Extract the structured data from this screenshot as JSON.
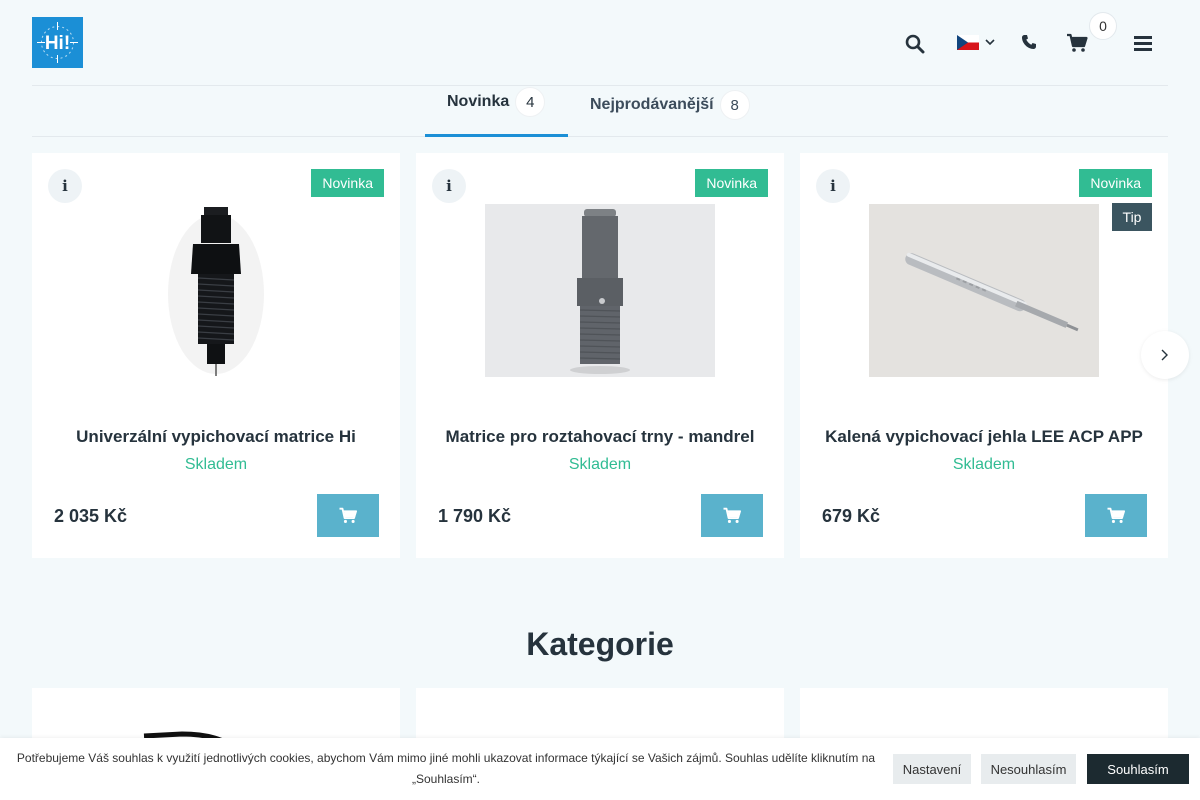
{
  "header": {
    "logo_text": "Hi!",
    "cart_count": "0",
    "icons": [
      "search-icon",
      "czech-flag-icon",
      "chevron-down-icon",
      "phone-icon",
      "cart-icon",
      "menu-icon"
    ]
  },
  "tabs": [
    {
      "label": "Novinka",
      "count": "4",
      "active": true
    },
    {
      "label": "Nejprodávanější",
      "count": "8",
      "active": false
    }
  ],
  "products": [
    {
      "name": "Univerzální vypichovací matrice Hi",
      "stock": "Skladem",
      "price": "2 035 Kč",
      "flag_new": "Novinka",
      "flag_tip": ""
    },
    {
      "name": "Matrice pro roztahovací trny - mandrel",
      "stock": "Skladem",
      "price": "1 790 Kč",
      "flag_new": "Novinka",
      "flag_tip": ""
    },
    {
      "name": "Kalená vypichovací jehla LEE ACP APP",
      "stock": "Skladem",
      "price": "679 Kč",
      "flag_new": "Novinka",
      "flag_tip": "Tip"
    }
  ],
  "categories": {
    "title": "Kategorie"
  },
  "cookie_bar": {
    "text": "Potřebujeme Váš souhlas k využití jednotlivých cookies, abychom Vám mimo jiné mohli ukazovat informace týkající se Vašich zájmů. Souhlas udělíte kliknutím na „Souhlasím“.",
    "settings_label": "Nastavení",
    "decline_label": "Nesouhlasím",
    "accept_label": "Souhlasím"
  },
  "colors": {
    "accent": "#1b8fd6",
    "new_flag": "#31bc93",
    "tip_flag": "#3b5560",
    "buy_button": "#5ab2cc",
    "stock": "#31bc93"
  }
}
